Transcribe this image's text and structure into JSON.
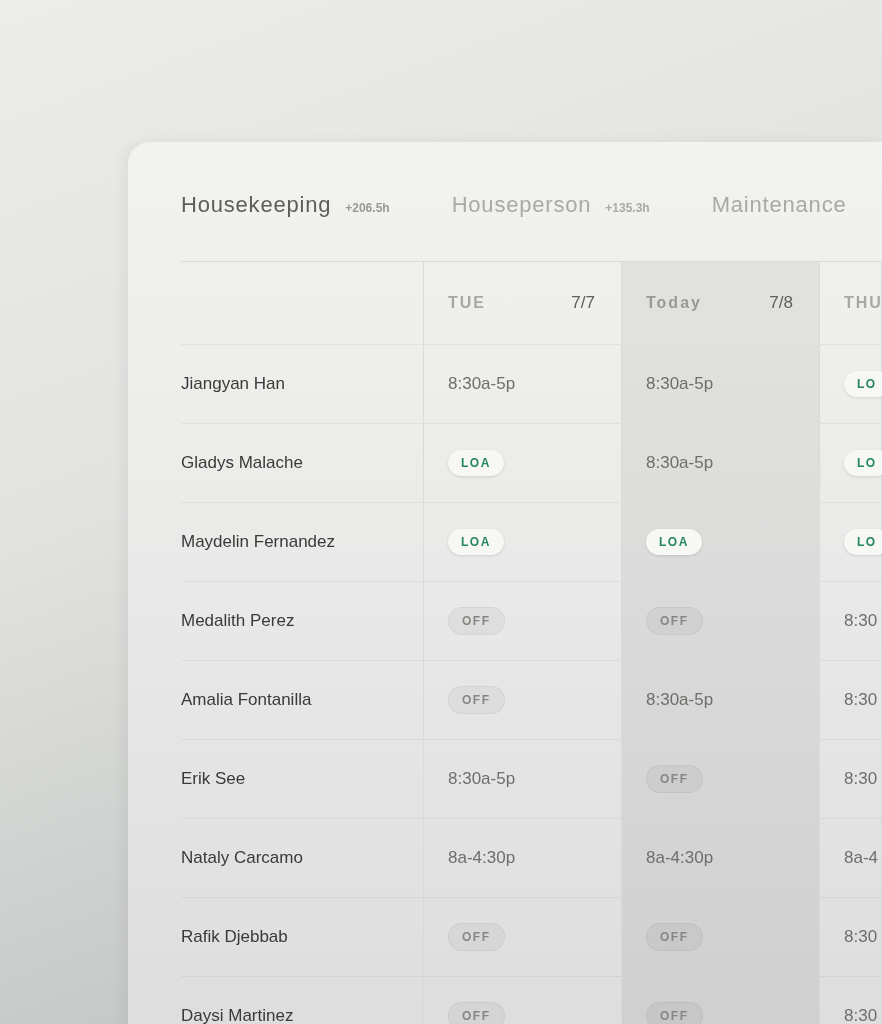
{
  "tabs": [
    {
      "label": "Housekeeping",
      "hours": "+206.5h",
      "selected": true
    },
    {
      "label": "Houseperson",
      "hours": "+135.3h",
      "selected": false
    },
    {
      "label": "Maintenance",
      "selected": false
    }
  ],
  "table": {
    "columns": [
      {
        "day": "TUE",
        "date": "7/7",
        "selected": false
      },
      {
        "day": "Today",
        "date": "7/8",
        "selected": true
      },
      {
        "day": "THU",
        "selected": false
      }
    ],
    "rows": [
      {
        "name": "Jiangyan Han",
        "cells": [
          {
            "kind": "shift",
            "text": "8:30a-5p"
          },
          {
            "kind": "shift",
            "text": "8:30a-5p"
          },
          {
            "kind": "loa",
            "text": "LO"
          }
        ]
      },
      {
        "name": "Gladys Malache",
        "cells": [
          {
            "kind": "loa",
            "text": "LOA"
          },
          {
            "kind": "shift",
            "text": "8:30a-5p"
          },
          {
            "kind": "loa",
            "text": "LO"
          }
        ]
      },
      {
        "name": "Maydelin Fernandez",
        "cells": [
          {
            "kind": "loa",
            "text": "LOA"
          },
          {
            "kind": "loa",
            "text": "LOA"
          },
          {
            "kind": "loa",
            "text": "LO"
          }
        ]
      },
      {
        "name": "Medalith Perez",
        "cells": [
          {
            "kind": "off",
            "text": "OFF"
          },
          {
            "kind": "off",
            "text": "OFF"
          },
          {
            "kind": "shift",
            "text": "8:30"
          }
        ]
      },
      {
        "name": "Amalia Fontanilla",
        "cells": [
          {
            "kind": "off",
            "text": "OFF"
          },
          {
            "kind": "shift",
            "text": "8:30a-5p"
          },
          {
            "kind": "shift",
            "text": "8:30"
          }
        ]
      },
      {
        "name": "Erik See",
        "cells": [
          {
            "kind": "shift",
            "text": "8:30a-5p"
          },
          {
            "kind": "off",
            "text": "OFF"
          },
          {
            "kind": "shift",
            "text": "8:30"
          }
        ]
      },
      {
        "name": "Nataly Carcamo",
        "cells": [
          {
            "kind": "shift",
            "text": "8a-4:30p"
          },
          {
            "kind": "shift",
            "text": "8a-4:30p"
          },
          {
            "kind": "shift",
            "text": "8a-4"
          }
        ]
      },
      {
        "name": "Rafik Djebbab",
        "cells": [
          {
            "kind": "off",
            "text": "OFF"
          },
          {
            "kind": "off",
            "text": "OFF"
          },
          {
            "kind": "shift",
            "text": "8:30"
          }
        ]
      },
      {
        "name": "Daysi Martinez",
        "cells": [
          {
            "kind": "off",
            "text": "OFF"
          },
          {
            "kind": "off",
            "text": "OFF"
          },
          {
            "kind": "shift",
            "text": "8:30"
          }
        ]
      }
    ]
  }
}
